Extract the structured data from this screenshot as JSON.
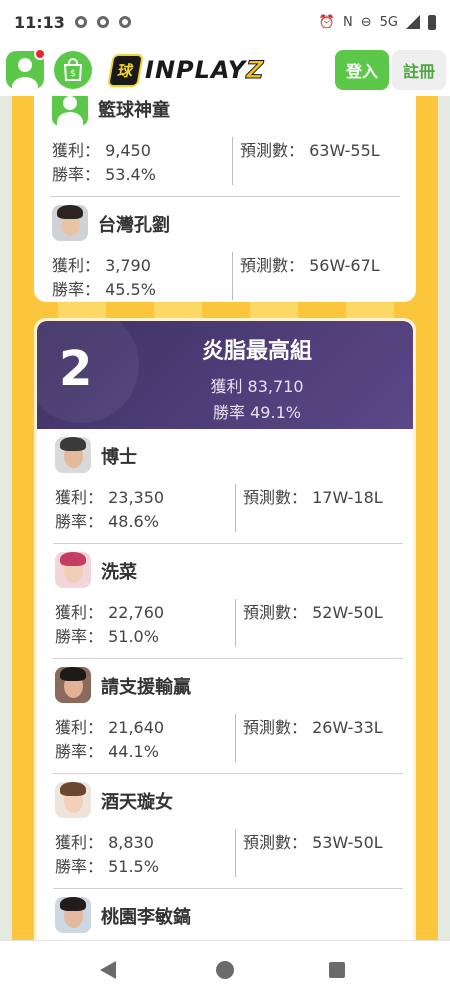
{
  "status_bar": {
    "time": "11:13",
    "network": "5G"
  },
  "header": {
    "brand_badge": "球",
    "brand_text": "INPLAY",
    "brand_z": "Z",
    "login_label": "登入",
    "register_label": "註冊"
  },
  "top_card": {
    "players": [
      {
        "name": "籃球神童",
        "avatar": "default-user-avatar",
        "profit_label": "獲利：",
        "profit": "9,450",
        "rate_label": "勝率：",
        "rate": "53.4%",
        "pred_label": "預測數：",
        "pred": "63W-55L"
      },
      {
        "name": "台灣孔劉",
        "avatar": "user-photo-avatar",
        "profit_label": "獲利：",
        "profit": "3,790",
        "rate_label": "勝率：",
        "rate": "45.5%",
        "pred_label": "預測數：",
        "pred": "56W-67L"
      }
    ]
  },
  "group": {
    "rank": "2",
    "title": "炎脂最高組",
    "profit": "獲利 83,710",
    "rate": "勝率 49.1%",
    "players": [
      {
        "name": "博士",
        "avatar": "user-photo-avatar",
        "profit_label": "獲利：",
        "profit": "23,350",
        "rate_label": "勝率：",
        "rate": "48.6%",
        "pred_label": "預測數：",
        "pred": "17W-18L"
      },
      {
        "name": "洗菜",
        "avatar": "user-photo-avatar",
        "profit_label": "獲利：",
        "profit": "22,760",
        "rate_label": "勝率：",
        "rate": "51.0%",
        "pred_label": "預測數：",
        "pred": "52W-50L"
      },
      {
        "name": "請支援輸贏",
        "avatar": "user-photo-avatar",
        "profit_label": "獲利：",
        "profit": "21,640",
        "rate_label": "勝率：",
        "rate": "44.1%",
        "pred_label": "預測數：",
        "pred": "26W-33L"
      },
      {
        "name": "酒天璇女",
        "avatar": "user-photo-avatar",
        "profit_label": "獲利：",
        "profit": "8,830",
        "rate_label": "勝率：",
        "rate": "51.5%",
        "pred_label": "預測數：",
        "pred": "53W-50L"
      },
      {
        "name": "桃園李敏鎬",
        "avatar": "user-photo-avatar"
      }
    ]
  },
  "colors": {
    "accent_green": "#5cc84a",
    "group_header": "#4a3a78",
    "stripe_orange": "#f7a020",
    "stripe_yellow": "#fbd05a"
  }
}
